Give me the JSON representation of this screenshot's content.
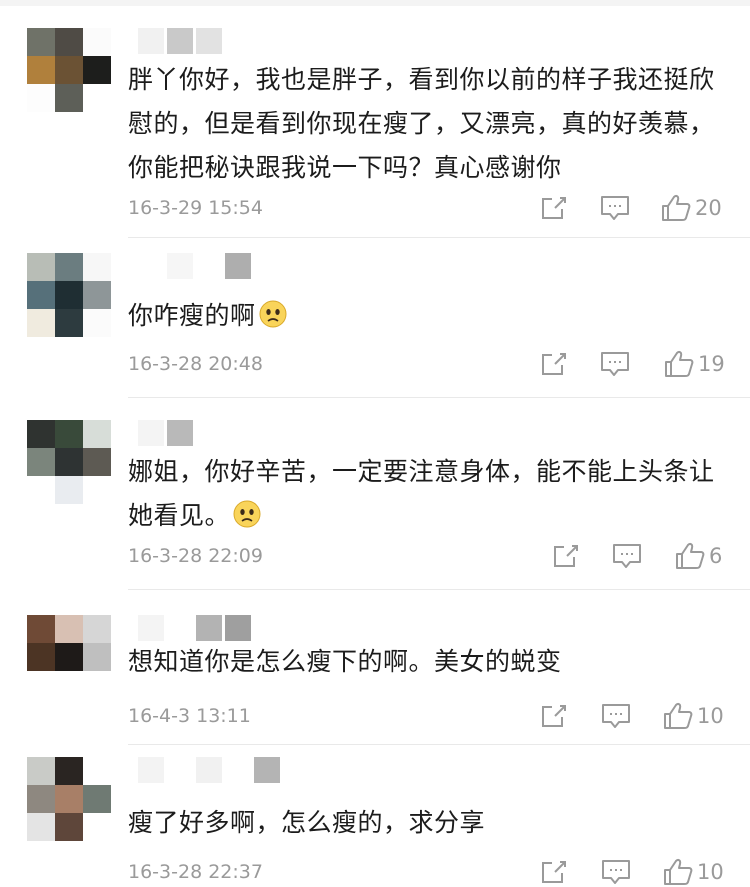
{
  "comments": [
    {
      "text": "胖丫你好，我也是胖子，看到你以前的样子我还挺欣慰的，但是看到你现在瘦了，又漂亮，真的好羡慕，你能把秘诀跟我说一下吗？真心感谢你",
      "emoji": false,
      "time": "16-3-29 15:54",
      "likes": "20"
    },
    {
      "text": "你咋瘦的啊",
      "emoji": true,
      "emoji_icon": "sad-face-emoji-icon",
      "time": "16-3-28 20:48",
      "likes": "19"
    },
    {
      "text": "娜姐，你好辛苦，一定要注意身体，能不能上头条让她看见。",
      "emoji": true,
      "emoji_icon": "sad-face-emoji-icon",
      "time": "16-3-28 22:09",
      "likes": "6"
    },
    {
      "text": "想知道你是怎么瘦下的啊。美女的蜕变",
      "emoji": false,
      "time": "16-4-3 13:11",
      "likes": "10"
    },
    {
      "text": "瘦了好多啊，怎么瘦的，求分享",
      "emoji": false,
      "time": "16-3-28 22:37",
      "likes": "10"
    }
  ],
  "icons": {
    "share": "share-icon",
    "reply": "comment-icon",
    "like": "thumbs-up-icon"
  },
  "colors": {
    "text": "#1c1c1c",
    "meta": "#9a9a9a",
    "icon": "#9a9a9a"
  }
}
